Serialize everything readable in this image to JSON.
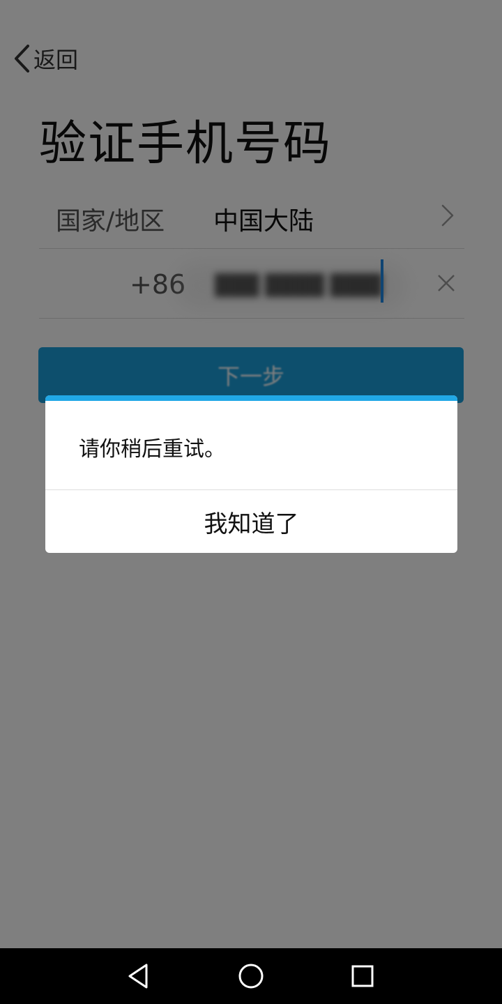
{
  "header": {
    "back_label": "返回"
  },
  "page": {
    "title": "验证手机号码"
  },
  "form": {
    "region_label": "国家/地区",
    "region_value": "中国大陆",
    "country_code": "+86",
    "phone_value": "███ ████ ████"
  },
  "next_button": {
    "label": "下一步"
  },
  "dialog": {
    "message": "请你稍后重试。",
    "ok_label": "我知道了"
  },
  "colors": {
    "accent": "#1a9edb",
    "dialog_bar": "#21a8e6",
    "overlay": "#000000"
  },
  "icons": {
    "back": "chevron-left-icon",
    "region": "chevron-right-icon",
    "clear": "close-icon",
    "nav_back": "triangle-back-icon",
    "nav_home": "circle-home-icon",
    "nav_recent": "square-recent-icon"
  }
}
